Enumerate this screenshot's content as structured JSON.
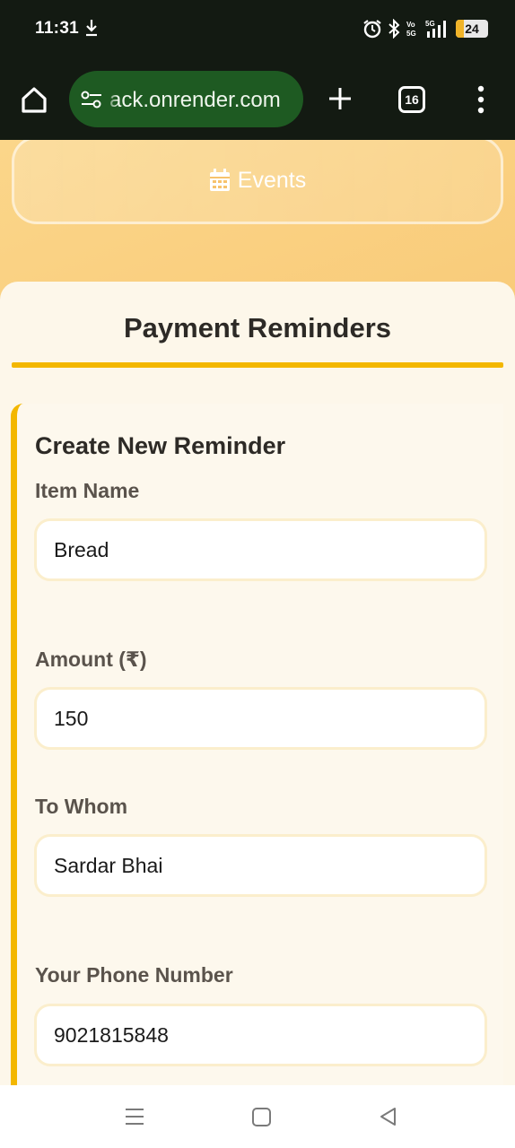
{
  "status_bar": {
    "time": "11:31",
    "battery_level": "24",
    "icons": [
      "download-icon",
      "alarm-icon",
      "bluetooth-icon",
      "volte-icon",
      "5g-signal-icon",
      "battery-icon"
    ]
  },
  "browser": {
    "url": "ack.onrender.com",
    "tab_count": "16"
  },
  "page": {
    "events_button": {
      "label": "Events",
      "icon": "calendar-icon"
    },
    "title": "Payment Reminders",
    "form": {
      "heading": "Create New Reminder",
      "fields": [
        {
          "label": "Item Name",
          "value": "Bread"
        },
        {
          "label": "Amount (₹)",
          "value": "150"
        },
        {
          "label": "To Whom",
          "value": "Sardar Bhai"
        },
        {
          "label": "Your Phone Number",
          "value": "9021815848"
        }
      ]
    }
  },
  "colors": {
    "status_bar_bg": "#131a12",
    "url_pill_bg": "#1e5a22",
    "page_gradient_start": "#fbd68a",
    "page_gradient_end": "#f5b45a",
    "accent": "#f3b700",
    "card_bg": "#fdf7ea"
  }
}
